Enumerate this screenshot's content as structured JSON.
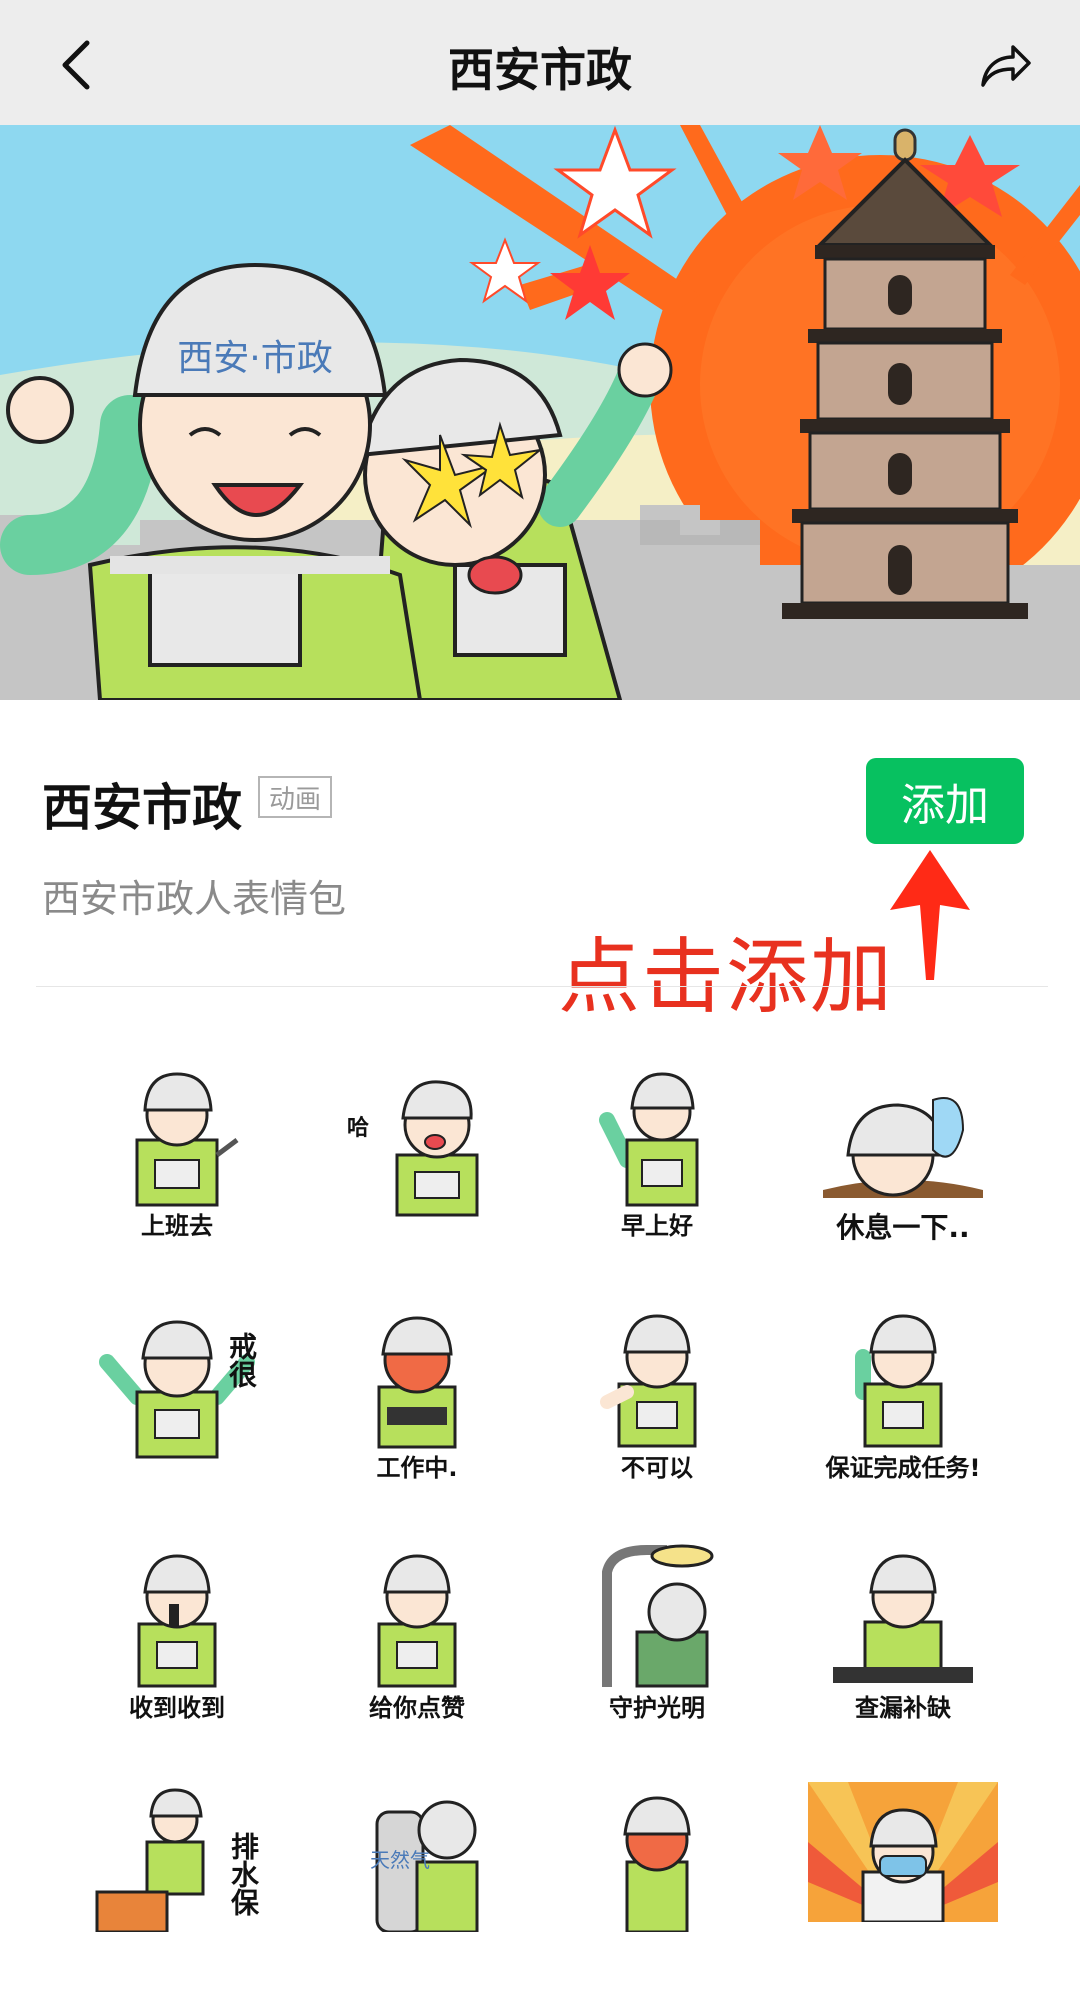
{
  "navbar": {
    "title": "西安市政",
    "back_icon": "chevron-left-icon",
    "share_icon": "share-icon"
  },
  "banner": {
    "helmet_text": "西安·市政"
  },
  "pack": {
    "title": "西安市政",
    "tag": "动画",
    "subtitle": "西安市政人表情包",
    "add_label": "添加",
    "add_color": "#07c160"
  },
  "annotation": {
    "text": "点击添加",
    "color": "#e8311f"
  },
  "stickers": [
    {
      "caption": "上班去"
    },
    {
      "caption": "哈"
    },
    {
      "caption": "早上好"
    },
    {
      "caption": "休息一下.."
    },
    {
      "caption": "戒很"
    },
    {
      "caption": "工作中."
    },
    {
      "caption": "不可以"
    },
    {
      "caption": "保证完成任务!"
    },
    {
      "caption": "收到收到"
    },
    {
      "caption": "给你点赞"
    },
    {
      "caption": "守护光明"
    },
    {
      "caption": "查漏补缺"
    },
    {
      "caption": "排水保"
    },
    {
      "caption": "天然气"
    },
    {
      "caption": ""
    },
    {
      "caption": ""
    }
  ]
}
